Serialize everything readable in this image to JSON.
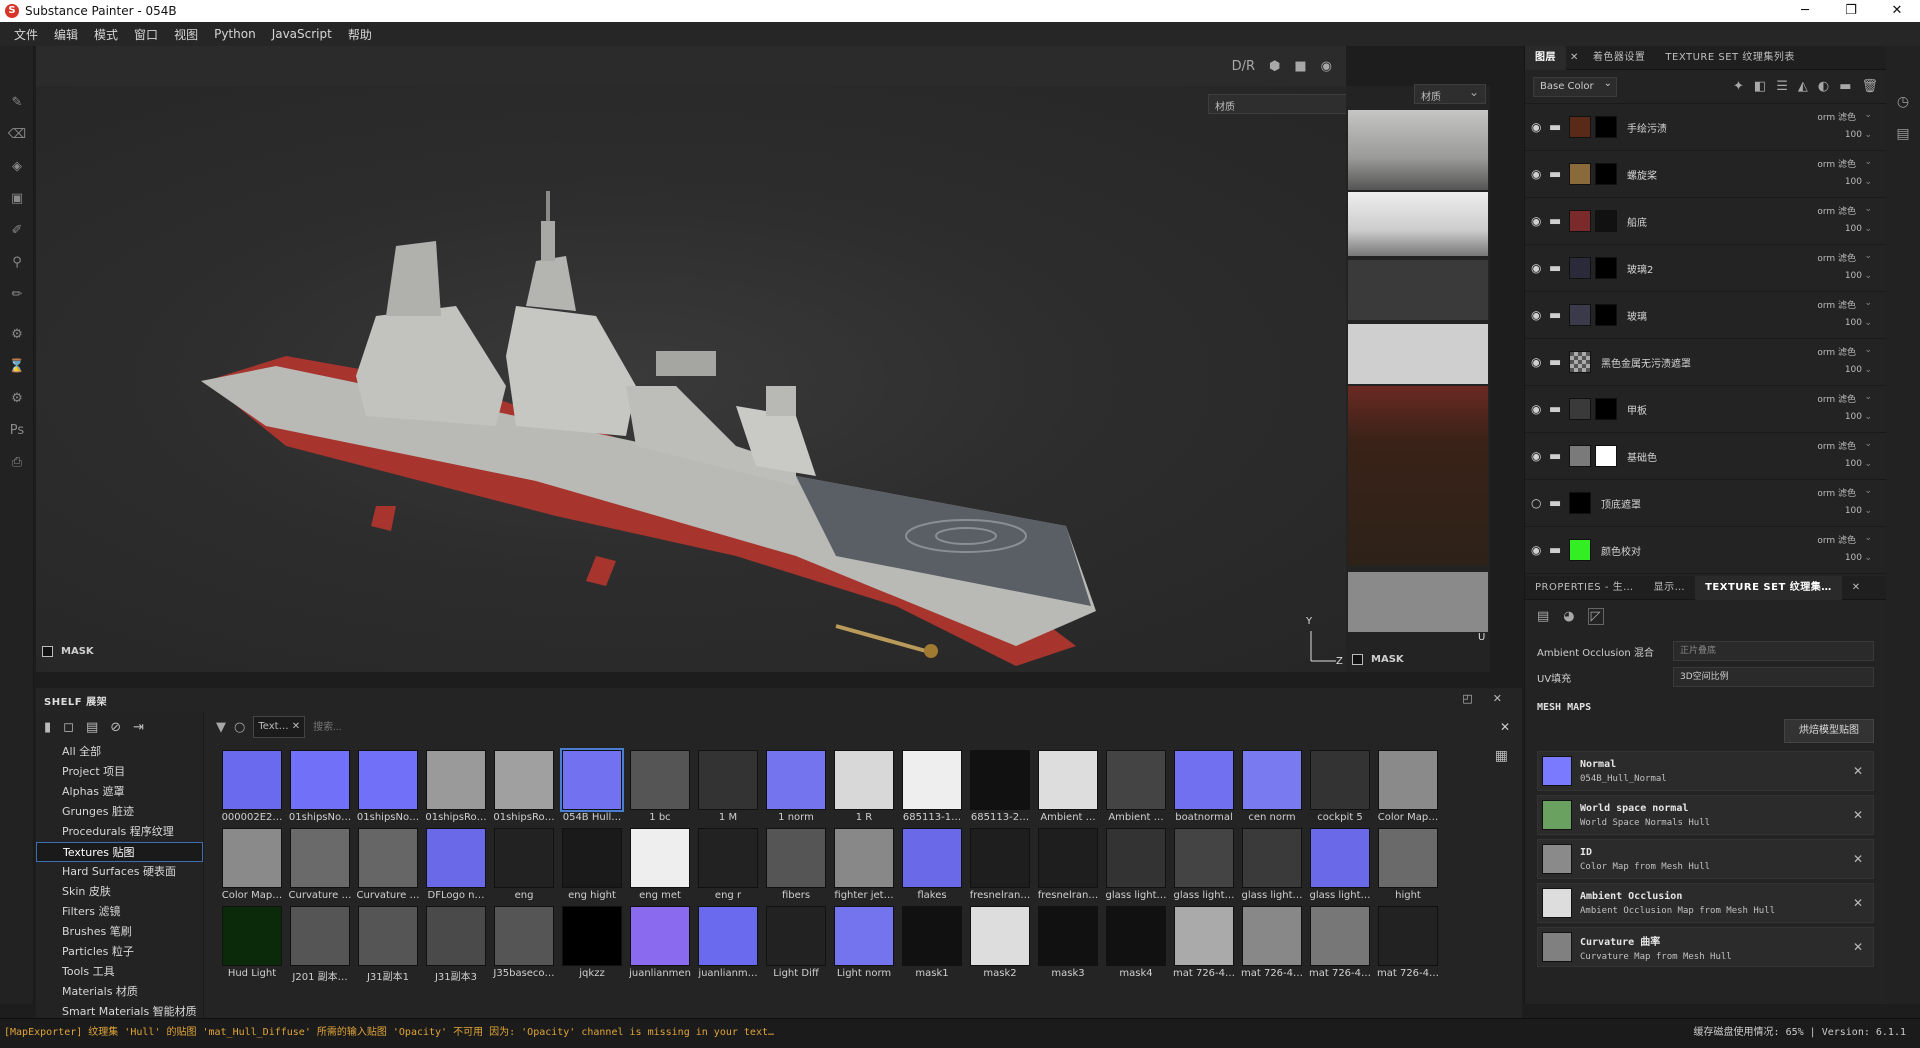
{
  "window": {
    "title": "Substance Painter - 054B",
    "controls": [
      "─",
      "❐",
      "✕"
    ]
  },
  "menu": [
    "文件",
    "编辑",
    "模式",
    "窗口",
    "视图",
    "Python",
    "JavaScript",
    "帮助"
  ],
  "viewport": {
    "toolbar": [
      "D/R",
      "cube",
      "camera",
      "snapshot"
    ],
    "material_select_3d": "材质",
    "material_select_2d": "材质",
    "mask_label": "MASK",
    "axis_y": "Y",
    "axis_z": "Z",
    "axis_u": "U"
  },
  "layers_panel": {
    "tabs": [
      "图层",
      "着色器设置",
      "TEXTURE SET 纹理集列表"
    ],
    "channel": "Base Color",
    "layers": [
      {
        "name": "手绘污渍",
        "blend": "orm 滤色",
        "opacity": "100",
        "thumb": "#5a2a18",
        "mask": "#000000",
        "visible": true
      },
      {
        "name": "螺旋桨",
        "blend": "orm 滤色",
        "opacity": "100",
        "thumb": "#8a6a3a",
        "mask": "#000000",
        "visible": true
      },
      {
        "name": "船底",
        "blend": "orm 滤色",
        "opacity": "100",
        "thumb": "#7a2a2a",
        "mask": "#111111",
        "visible": true
      },
      {
        "name": "玻璃2",
        "blend": "orm 滤色",
        "opacity": "100",
        "thumb": "#2a2a3a",
        "mask": "#000000",
        "visible": true
      },
      {
        "name": "玻璃",
        "blend": "orm 滤色",
        "opacity": "100",
        "thumb": "#3a3a4a",
        "mask": "#000000",
        "visible": true
      },
      {
        "name": "黑色金属无污渍遮罩",
        "blend": "orm 滤色",
        "opacity": "100",
        "thumb": "#888888",
        "mask": "",
        "visible": true
      },
      {
        "name": "甲板",
        "blend": "orm 滤色",
        "opacity": "100",
        "thumb": "#3a3a3a",
        "mask": "#000000",
        "visible": true
      },
      {
        "name": "基础色",
        "blend": "orm 滤色",
        "opacity": "100",
        "thumb": "#7a7a7a",
        "mask": "#ffffff",
        "visible": true
      },
      {
        "name": "顶底遮罩",
        "blend": "orm 滤色",
        "opacity": "100",
        "thumb": "#000000",
        "mask": "",
        "visible": false
      },
      {
        "name": "颜色校对",
        "blend": "orm 滤色",
        "opacity": "100",
        "thumb": "#33ee22",
        "mask": "",
        "visible": true
      }
    ]
  },
  "properties_panel": {
    "tabs": [
      "PROPERTIES - 生…",
      "显示…",
      "TEXTURE SET 纹理集…"
    ],
    "rows": [
      {
        "label": "Ambient Occlusion 混合",
        "value": "正片叠底"
      },
      {
        "label": "UV填充",
        "value": "3D空间比例"
      }
    ],
    "mesh_maps_title": "MESH MAPS",
    "bake_button": "烘焙模型贴图",
    "mesh_maps": [
      {
        "title": "Normal",
        "sub": "054B_Hull_Normal",
        "color": "#7a7aff"
      },
      {
        "title": "World space normal",
        "sub": "World Space Normals Hull",
        "color": "#6aa060"
      },
      {
        "title": "ID",
        "sub": "Color Map from Mesh Hull",
        "color": "#8a8a8a"
      },
      {
        "title": "Ambient Occlusion",
        "sub": "Ambient Occlusion Map from Mesh Hull",
        "color": "#dddddd"
      },
      {
        "title": "Curvature 曲率",
        "sub": "Curvature Map from Mesh Hull",
        "color": "#808080"
      }
    ]
  },
  "shelf": {
    "title": "SHELF 展架",
    "categories": [
      "All 全部",
      "Project 项目",
      "Alphas 遮罩",
      "Grunges 脏迹",
      "Procedurals 程序纹理",
      "Textures 贴图",
      "Hard Surfaces 硬表面",
      "Skin 皮肤",
      "Filters 滤镜",
      "Brushes 笔刷",
      "Particles 粒子",
      "Tools 工具",
      "Materials 材质",
      "Smart Materials 智能材质"
    ],
    "active_category": "Textures 贴图",
    "filter_chip": "Text…",
    "search_placeholder": "搜索...",
    "items": [
      {
        "label": "000002E2…",
        "color": "#6a6aee"
      },
      {
        "label": "01shipsNo…",
        "color": "#7070f8"
      },
      {
        "label": "01shipsNo…",
        "color": "#7070f8"
      },
      {
        "label": "01shipsRo…",
        "color": "#9a9a9a"
      },
      {
        "label": "01shipsRo…",
        "color": "#a0a0a0"
      },
      {
        "label": "054B Hull…",
        "color": "#7272f0"
      },
      {
        "label": "1 bc",
        "color": "#555555"
      },
      {
        "label": "1 M",
        "color": "#333333"
      },
      {
        "label": "1 norm",
        "color": "#7474ee"
      },
      {
        "label": "1 R",
        "color": "#d8d8d8"
      },
      {
        "label": "685113-1…",
        "color": "#eeeeee"
      },
      {
        "label": "685113-2…",
        "color": "#111111"
      },
      {
        "label": "Ambient …",
        "color": "#dddddd"
      },
      {
        "label": "Ambient …",
        "color": "#444444"
      },
      {
        "label": "boatnormal",
        "color": "#7070f0"
      },
      {
        "label": "cen norm",
        "color": "#7a7af0"
      },
      {
        "label": "cockpit 5",
        "color": "#333333"
      },
      {
        "label": "Color Map…",
        "color": "#8a8a8a"
      },
      {
        "label": "Color Map…",
        "color": "#8a8a8a"
      },
      {
        "label": "Curvature …",
        "color": "#6a6a6a"
      },
      {
        "label": "Curvature …",
        "color": "#666666"
      },
      {
        "label": "DFLogo n…",
        "color": "#6a6ae8"
      },
      {
        "label": "eng",
        "color": "#222222"
      },
      {
        "label": "eng hight",
        "color": "#1a1a1a"
      },
      {
        "label": "eng met",
        "color": "#eeeeee"
      },
      {
        "label": "eng r",
        "color": "#222222"
      },
      {
        "label": "fibers",
        "color": "#555555"
      },
      {
        "label": "fighter jet…",
        "color": "#888888"
      },
      {
        "label": "flakes",
        "color": "#6a6ae8"
      },
      {
        "label": "fresnelran…",
        "color": "#1e1e1e"
      },
      {
        "label": "fresnelran…",
        "color": "#1e1e1e"
      },
      {
        "label": "glass light…",
        "color": "#333333"
      },
      {
        "label": "glass light…",
        "color": "#444444"
      },
      {
        "label": "glass light…",
        "color": "#3a3a3a"
      },
      {
        "label": "glass light…",
        "color": "#6a6ae8"
      },
      {
        "label": "hight",
        "color": "#6a6a6a"
      },
      {
        "label": "Hud Light",
        "color": "#0a2a0a"
      },
      {
        "label": "J201 副本…",
        "color": "#555555"
      },
      {
        "label": "J31副本1",
        "color": "#555555"
      },
      {
        "label": "J31副本3",
        "color": "#4a4a4a"
      },
      {
        "label": "J35baseco…",
        "color": "#555555"
      },
      {
        "label": "jqkzz",
        "color": "#000000"
      },
      {
        "label": "juanlianmen",
        "color": "#8a6aee"
      },
      {
        "label": "juanlianm…",
        "color": "#6a6aee"
      },
      {
        "label": "Light Diff",
        "color": "#222222"
      },
      {
        "label": "Light norm",
        "color": "#7474ee"
      },
      {
        "label": "mask1",
        "color": "#111111"
      },
      {
        "label": "mask2",
        "color": "#dddddd"
      },
      {
        "label": "mask3",
        "color": "#111111"
      },
      {
        "label": "mask4",
        "color": "#111111"
      },
      {
        "label": "mat 726-4…",
        "color": "#aaaaaa"
      },
      {
        "label": "mat 726-4…",
        "color": "#888888"
      },
      {
        "label": "mat 726-4…",
        "color": "#777777"
      },
      {
        "label": "mat 726-4…",
        "color": "#222222"
      }
    ]
  },
  "status": {
    "message": "[MapExporter] 纹理集 'Hull' 的贴图 'mat_Hull_Diffuse' 所需的输入贴图 'Opacity' 不可用 因为: 'Opacity' channel is missing in your text…",
    "cache": "缓存磁盘使用情况:  65%",
    "version": "Version: 6.1.1"
  }
}
